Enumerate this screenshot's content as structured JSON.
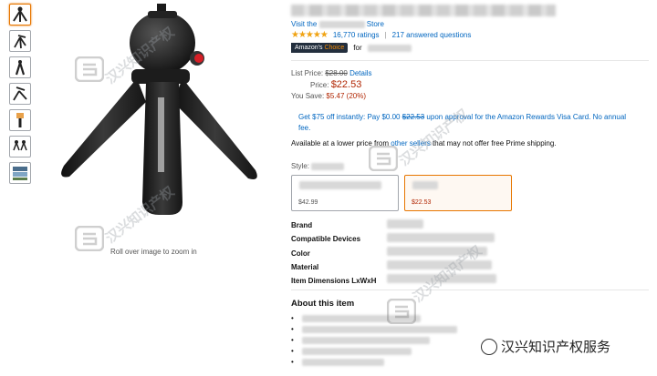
{
  "store": {
    "prefix": "Visit the",
    "suffix": "Store"
  },
  "rating": {
    "stars": "★★★★★",
    "count": "16,770 ratings",
    "questions": "217 answered questions",
    "separator": "|"
  },
  "badge": {
    "prefix": "Amazon's",
    "accent": "Choice",
    "for_label": "for"
  },
  "price": {
    "list_label": "List Price:",
    "list_value": "$28.00",
    "details": "Details",
    "price_label": "Price:",
    "price_value": "$22.53",
    "save_label": "You Save:",
    "save_value": "$5.47 (20%)"
  },
  "promo": {
    "before": "Get $75 off instantly: Pay $0.00",
    "strike": "$22.53",
    "after": "upon approval for the Amazon Rewards Visa Card. No annual fee."
  },
  "availability": {
    "before": "Available at a lower price from",
    "link": "other sellers",
    "after": "that may not offer free Prime shipping."
  },
  "style": {
    "label": "Style:",
    "options": [
      {
        "price": "$42.99"
      },
      {
        "price": "$22.53"
      }
    ]
  },
  "specs": [
    "Brand",
    "Compatible Devices",
    "Color",
    "Material",
    "Item Dimensions LxWxH"
  ],
  "about": {
    "title": "About this item",
    "bullet_char": "•"
  },
  "zoom_hint": "Roll over image to zoom in",
  "watermark": {
    "brand": "汉兴知识产权服务",
    "diagonal": "汉兴知识产权"
  },
  "colors": {
    "link": "#0066c0",
    "price": "#b12704",
    "star": "#f0a313",
    "badge_bg": "#232f3e",
    "badge_accent": "#f08804",
    "selected_border": "#e77600"
  }
}
